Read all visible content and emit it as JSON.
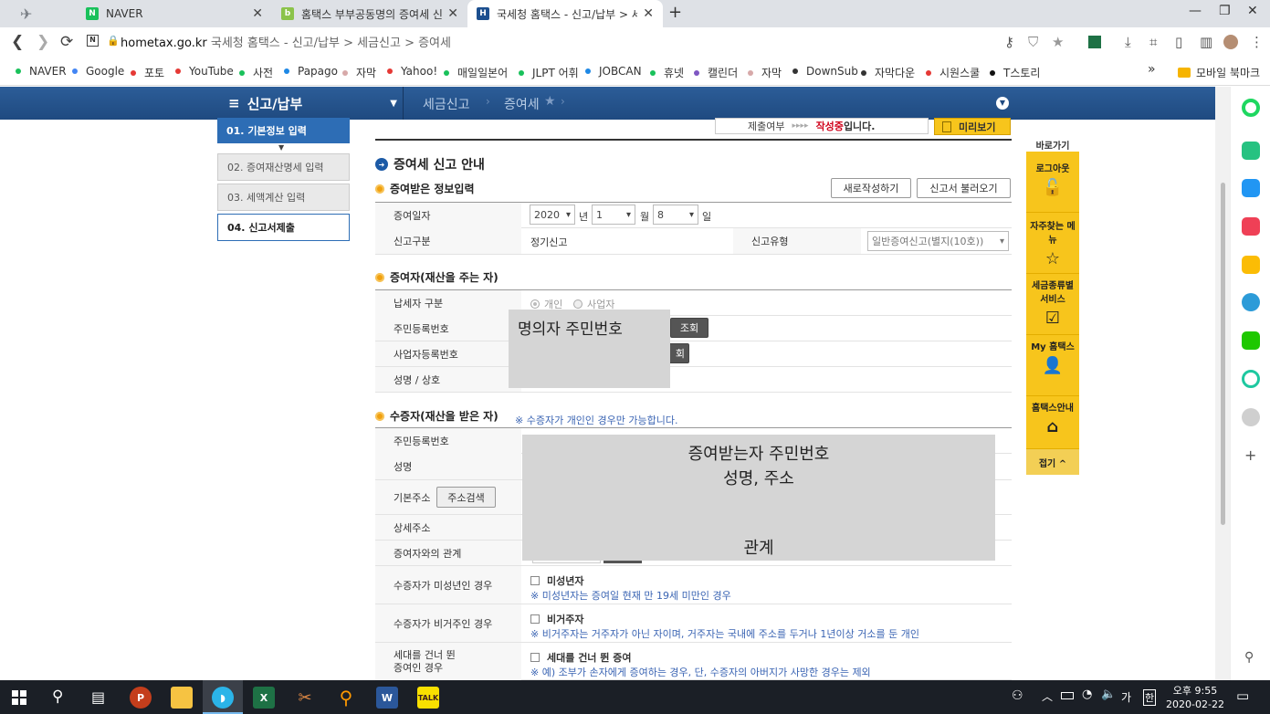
{
  "tabs": [
    {
      "title": "NAVER",
      "active": false
    },
    {
      "title": "홈택스 부부공동명의 증여세 신고",
      "active": false
    },
    {
      "title": "국세청 홈택스 - 신고/납부 > 세",
      "active": true
    }
  ],
  "new_tab": "+",
  "window": {
    "minimize": "—",
    "restore": "❐",
    "close": "✕"
  },
  "address": {
    "host": "hometax.go.kr",
    "path": "국세청 홈택스 - 신고/납부 > 세금신고 > 증여세"
  },
  "bookmarks": [
    {
      "label": "NAVER",
      "color": "#19c15b"
    },
    {
      "label": "Google",
      "color": "#4285f4"
    },
    {
      "label": "포토",
      "color": "#e53935"
    },
    {
      "label": "YouTube",
      "color": "#e53935"
    },
    {
      "label": "사전",
      "color": "#19c15b"
    },
    {
      "label": "Papago",
      "color": "#1e88e5"
    },
    {
      "label": "자막",
      "color": "#d7a9a9"
    },
    {
      "label": "Yahoo!",
      "color": "#e53935"
    },
    {
      "label": "매일일본어",
      "color": "#19c15b"
    },
    {
      "label": "JLPT 어휘",
      "color": "#19c15b"
    },
    {
      "label": "JOBCAN",
      "color": "#1e88e5"
    },
    {
      "label": "휴넷",
      "color": "#19c15b"
    },
    {
      "label": "캘린더",
      "color": "#7e57c2"
    },
    {
      "label": "자막",
      "color": "#d7a9a9"
    },
    {
      "label": "DownSub",
      "color": "#333"
    },
    {
      "label": "자막다운",
      "color": "#333"
    },
    {
      "label": "시원스쿨",
      "color": "#e53935"
    },
    {
      "label": "T스토리",
      "color": "#111"
    }
  ],
  "bookmarks_more": "»",
  "mobile_bookmarks": "모바일 북마크",
  "site_nav": {
    "menu": "신고/납부",
    "crumb1": "세금신고",
    "crumb2": "증여세"
  },
  "top_status": {
    "label": "제출여부",
    "arrows": "▸▸▸▸",
    "status": "작성중",
    "suffix": "입니다.",
    "preview": "미리보기"
  },
  "steps": [
    {
      "label": "01. 기본정보 입력",
      "state": "active"
    },
    {
      "label": "02. 증여재산명세 입력",
      "state": "todo"
    },
    {
      "label": "03. 세액계산 입력",
      "state": "todo"
    },
    {
      "label": "04. 신고서제출",
      "state": "outlined"
    }
  ],
  "main": {
    "title": "증여세 신고 안내",
    "gift_info": {
      "section": "증여받은 정보입력",
      "btn_new": "새로작성하기",
      "btn_load": "신고서 불러오기",
      "date_label": "증여일자",
      "year": "2020",
      "year_unit": "년",
      "month": "1",
      "month_unit": "월",
      "day": "8",
      "day_unit": "일",
      "type_label": "신고구분",
      "type_value": "정기신고",
      "kind_label": "신고유형",
      "kind_value": "일반증여신고(별지(10호))"
    },
    "donor": {
      "section": "증여자(재산을 주는 자)",
      "taxpayer_label": "납세자 구분",
      "opt_individual": "개인",
      "opt_business": "사업자",
      "rrn_label": "주민등록번호",
      "lookup": "조회",
      "brn_label": "사업자등록번호",
      "lookup2": "회",
      "name_label": "성명 / 상호",
      "overlay": "명의자 주민번호"
    },
    "recipient": {
      "section": "수증자(재산을 받은 자)",
      "note": "※ 수증자가 개인인 경우만 가능합니다.",
      "rrn_label": "주민등록번호",
      "name_label": "성명",
      "addr_label": "기본주소",
      "addr_search": "주소검색",
      "addr_detail_label": "상세주소",
      "relation_label": "증여자와의 관계",
      "overlay_line1": "증여받는자 주민번호",
      "overlay_line2": "성명, 주소",
      "overlay_line3": "관계",
      "minor_label": "수증자가 미성년인 경우",
      "minor_cb": "미성년자",
      "minor_note": "※ 미성년자는 증여일 현재 만 19세 미만인 경우",
      "nonres_label": "수증자가 비거주인 경우",
      "nonres_cb": "비거주자",
      "nonres_note": "※ 비거주자는 거주자가 아닌 자이며, 거주자는 국내에 주소를 두거나 1년이상 거소를 둔 개인",
      "skip_label1": "세대를 건너 뛴",
      "skip_label2": "증여인 경우",
      "skip_cb": "세대를 건너 뛴 증여",
      "skip_note": "※ 예) 조부가 손자에게 증여하는 경우, 단, 수증자의 아버지가 사망한 경우는 제외"
    }
  },
  "quick": {
    "title": "바로가기",
    "items": [
      "로그아웃",
      "자주찾는 메뉴",
      "세금종류별 서비스",
      "My 홈택스",
      "홈택스안내"
    ],
    "fold": "접기 ^"
  },
  "taskbar": {
    "time": "오후 9:55",
    "date": "2020-02-22",
    "ime": "가",
    "ime2": "한"
  }
}
